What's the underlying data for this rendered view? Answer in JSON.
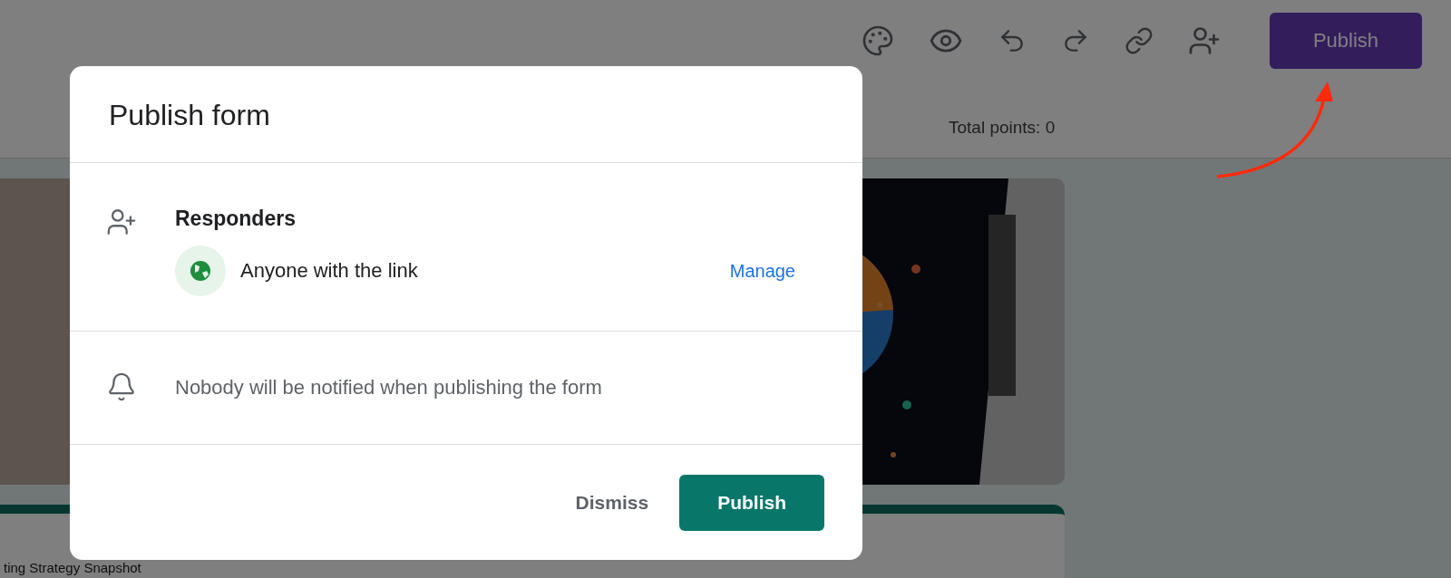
{
  "header": {
    "publish_button": "Publish",
    "total_points": "Total points: 0"
  },
  "form": {
    "title_fragment": "ting Strategy Snapshot"
  },
  "dialog": {
    "title": "Publish form",
    "responders": {
      "heading": "Responders",
      "access": "Anyone with the link",
      "action": "Manage"
    },
    "notice": "Nobody will be notified when publishing the form",
    "buttons": [
      {
        "label": "Dismiss",
        "kind": "text"
      },
      {
        "label": "Publish",
        "kind": "filled"
      }
    ]
  }
}
